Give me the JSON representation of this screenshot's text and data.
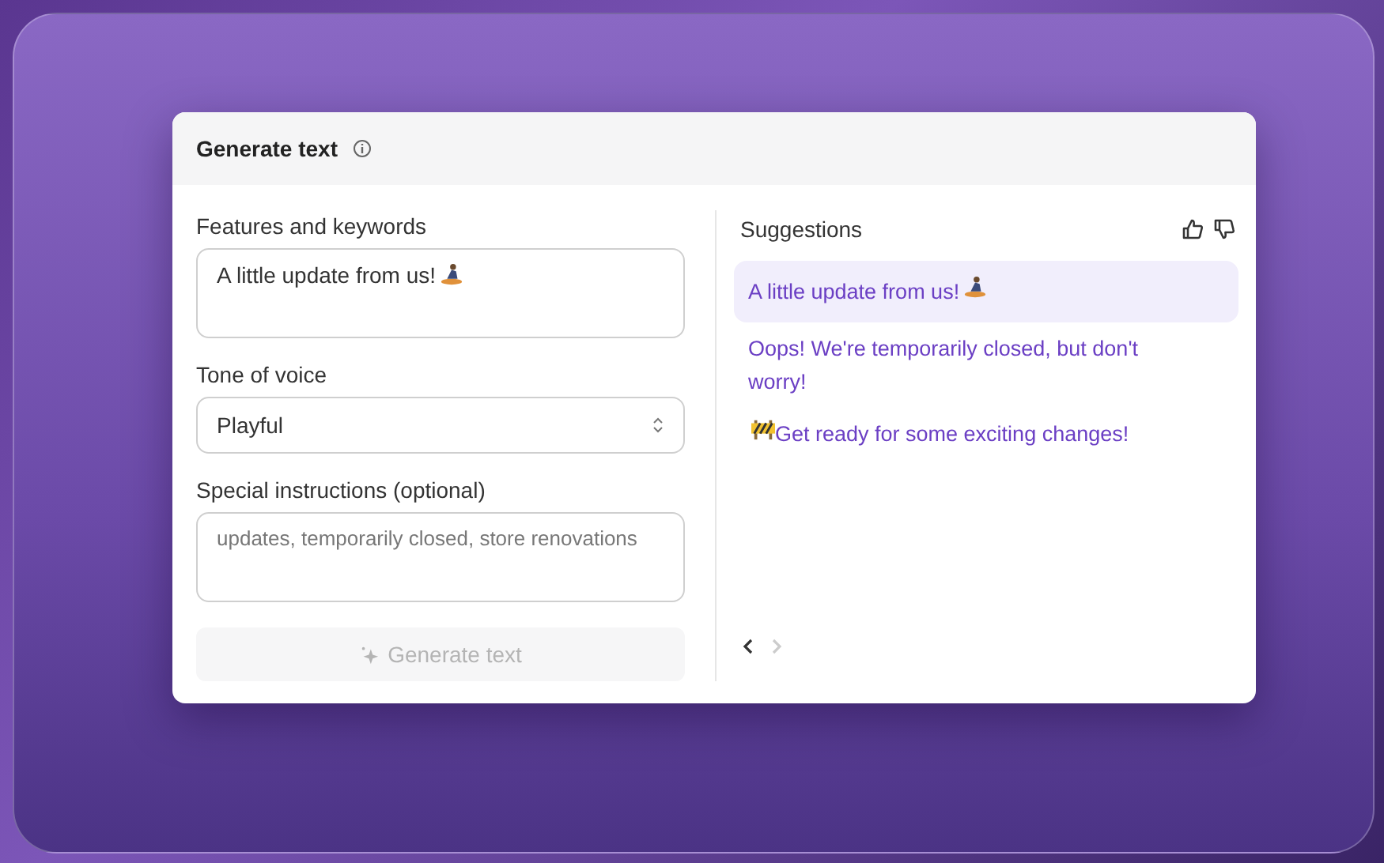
{
  "dialog": {
    "title": "Generate text"
  },
  "form": {
    "keywords": {
      "label": "Features and keywords",
      "value": "A little update from us!",
      "surfer_emoji": true
    },
    "tone": {
      "label": "Tone of voice",
      "value": "Playful"
    },
    "instructions": {
      "label": "Special instructions (optional)",
      "placeholder": "updates, temporarily closed, store renovations"
    },
    "generate_button": {
      "label": "Generate text",
      "disabled": true
    }
  },
  "suggestions": {
    "title": "Suggestions",
    "items": [
      {
        "text": "A little update from us!",
        "surfer_emoji": true,
        "selected": true
      },
      {
        "text": "Oops! We're temporarily closed, but don't worry!",
        "selected": false
      },
      {
        "text": "Get ready for some exciting changes!",
        "barrier_emoji": true,
        "selected": false
      }
    ],
    "prev_disabled": false,
    "next_disabled": true
  }
}
